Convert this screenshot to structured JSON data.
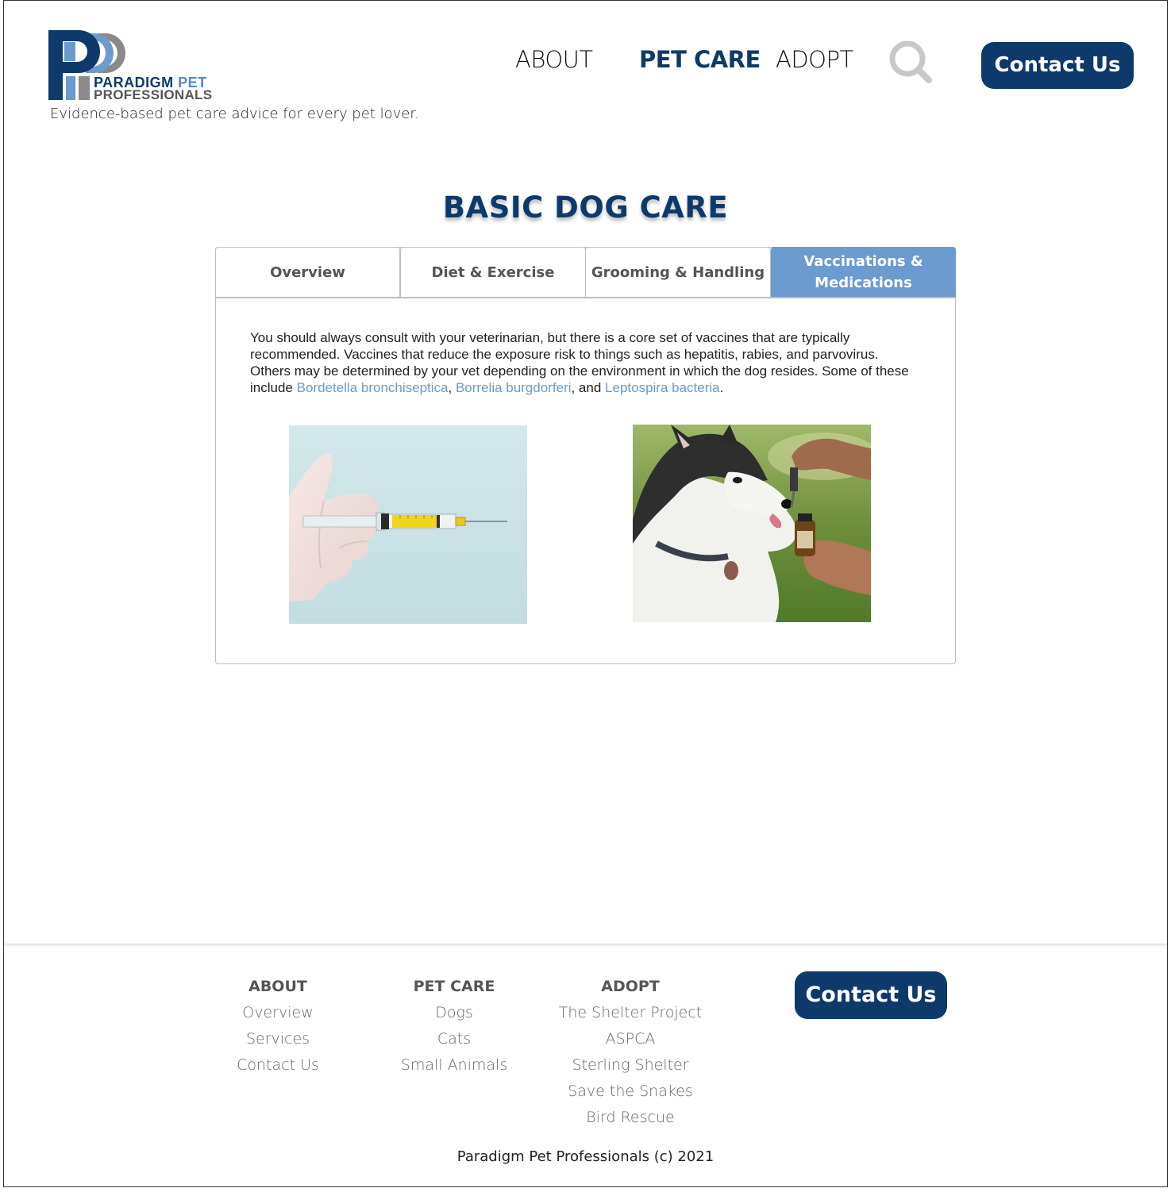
{
  "header": {
    "logo_name": "PARADIGM",
    "logo_pet": " PET",
    "logo_line2": "PROFESSIONALS",
    "tagline": "Evidence-based pet care advice for every pet lover.",
    "nav": [
      {
        "label": "ABOUT",
        "active": false
      },
      {
        "label": "PET CARE",
        "active": true
      },
      {
        "label": "ADOPT",
        "active": false
      }
    ],
    "search_icon": "search-icon",
    "contact_label": "Contact Us"
  },
  "colors": {
    "brand_navy": "#0d3a6b",
    "accent_blue": "#6b9bcf",
    "logo_gray": "#8a8a8a"
  },
  "main": {
    "title": "BASIC DOG CARE",
    "tabs": [
      {
        "label": "Overview",
        "active": false
      },
      {
        "label": "Diet & Exercise",
        "active": false
      },
      {
        "label": "Grooming & Handling",
        "active": false
      },
      {
        "label_line1": "Vaccinations &",
        "label_line2": "Medications",
        "active": true
      }
    ],
    "content": {
      "text_before": "You should always consult with your veterinarian, but there is a core set of vaccines that are typically recommended. Vaccines that reduce the exposure risk to things such as hepatitis, rabies, and parvovirus. Others may be determined by your vet depending on the environment in which the dog resides. Some of these include ",
      "link_1": "Bordetella bronchiseptica",
      "sep_1": ", ",
      "link_2": "Borrelia burgdorferi",
      "sep_2": ", and ",
      "link_3": "Leptospira bacteria",
      "text_after": "."
    },
    "images": [
      "syringe-photo",
      "husky-dropper-photo"
    ]
  },
  "footer": {
    "columns": [
      {
        "heading": "ABOUT",
        "links": [
          "Overview",
          "Services",
          "Contact Us"
        ]
      },
      {
        "heading": "PET CARE",
        "links": [
          "Dogs",
          "Cats",
          "Small Animals"
        ]
      },
      {
        "heading": "ADOPT",
        "links": [
          "The Shelter Project",
          "ASPCA",
          "Sterling Shelter",
          "Save the Snakes",
          "Bird Rescue"
        ]
      }
    ],
    "contact_label": "Contact Us",
    "copyright": "Paradigm Pet Professionals (c) 2021"
  }
}
